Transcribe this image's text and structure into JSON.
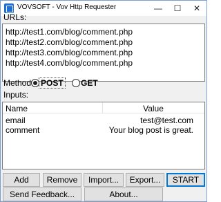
{
  "window": {
    "title": "VOVSOFT - Vov Http Requester",
    "minimize": "—",
    "maximize": "☐",
    "close": "✕"
  },
  "urls": {
    "label": "URLs:",
    "lines": [
      "http://test1.com/blog/comment.php",
      "http://test2.com/blog/comment.php",
      "http://test3.com/blog/comment.php",
      "http://test4.com/blog/comment.php"
    ]
  },
  "method": {
    "label": "Method:",
    "options": [
      "POST",
      "GET"
    ],
    "selected": "POST"
  },
  "inputs": {
    "label": "Inputs:",
    "columns": [
      "Name",
      "Value"
    ],
    "rows": [
      {
        "name": "email",
        "value": "test@test.com"
      },
      {
        "name": "comment",
        "value": "Your blog post is great."
      }
    ]
  },
  "buttons": {
    "add": "Add",
    "remove": "Remove",
    "import": "Import...",
    "export": "Export...",
    "start": "START",
    "send_feedback": "Send Feedback...",
    "about": "About..."
  }
}
